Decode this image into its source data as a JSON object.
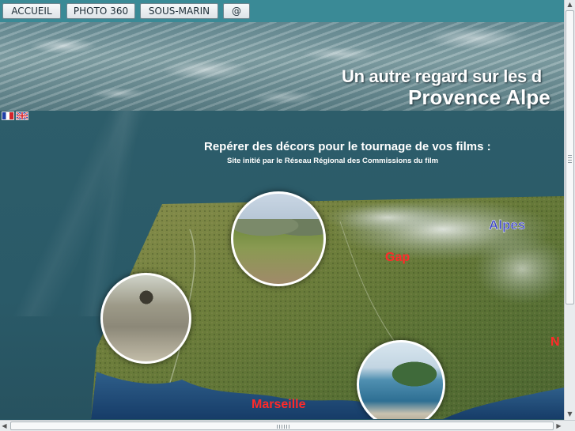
{
  "nav": {
    "items": [
      {
        "label": "ACCUEIL"
      },
      {
        "label": "PHOTO 360"
      },
      {
        "label": "SOUS-MARIN"
      },
      {
        "label": "@"
      }
    ]
  },
  "banner": {
    "line1": "Un autre regard sur les d",
    "line2": "Provence Alpe"
  },
  "languages": [
    "fr",
    "en"
  ],
  "main": {
    "headline": "Repérer des décors pour le tournage de vos films :",
    "subline": "Site initié par le Réseau Régional des Commissions du film"
  },
  "map": {
    "cities": [
      {
        "name": "Alpes",
        "color": "#3d46c4"
      },
      {
        "name": "Gap",
        "color": "#ff2a2a"
      },
      {
        "name": "Marseille",
        "color": "#ff2a2a"
      },
      {
        "name": "N",
        "color": "#ff2a2a"
      }
    ],
    "photos": [
      "mountain-meadow-photo",
      "village-square-photo",
      "coastline-photo"
    ]
  }
}
